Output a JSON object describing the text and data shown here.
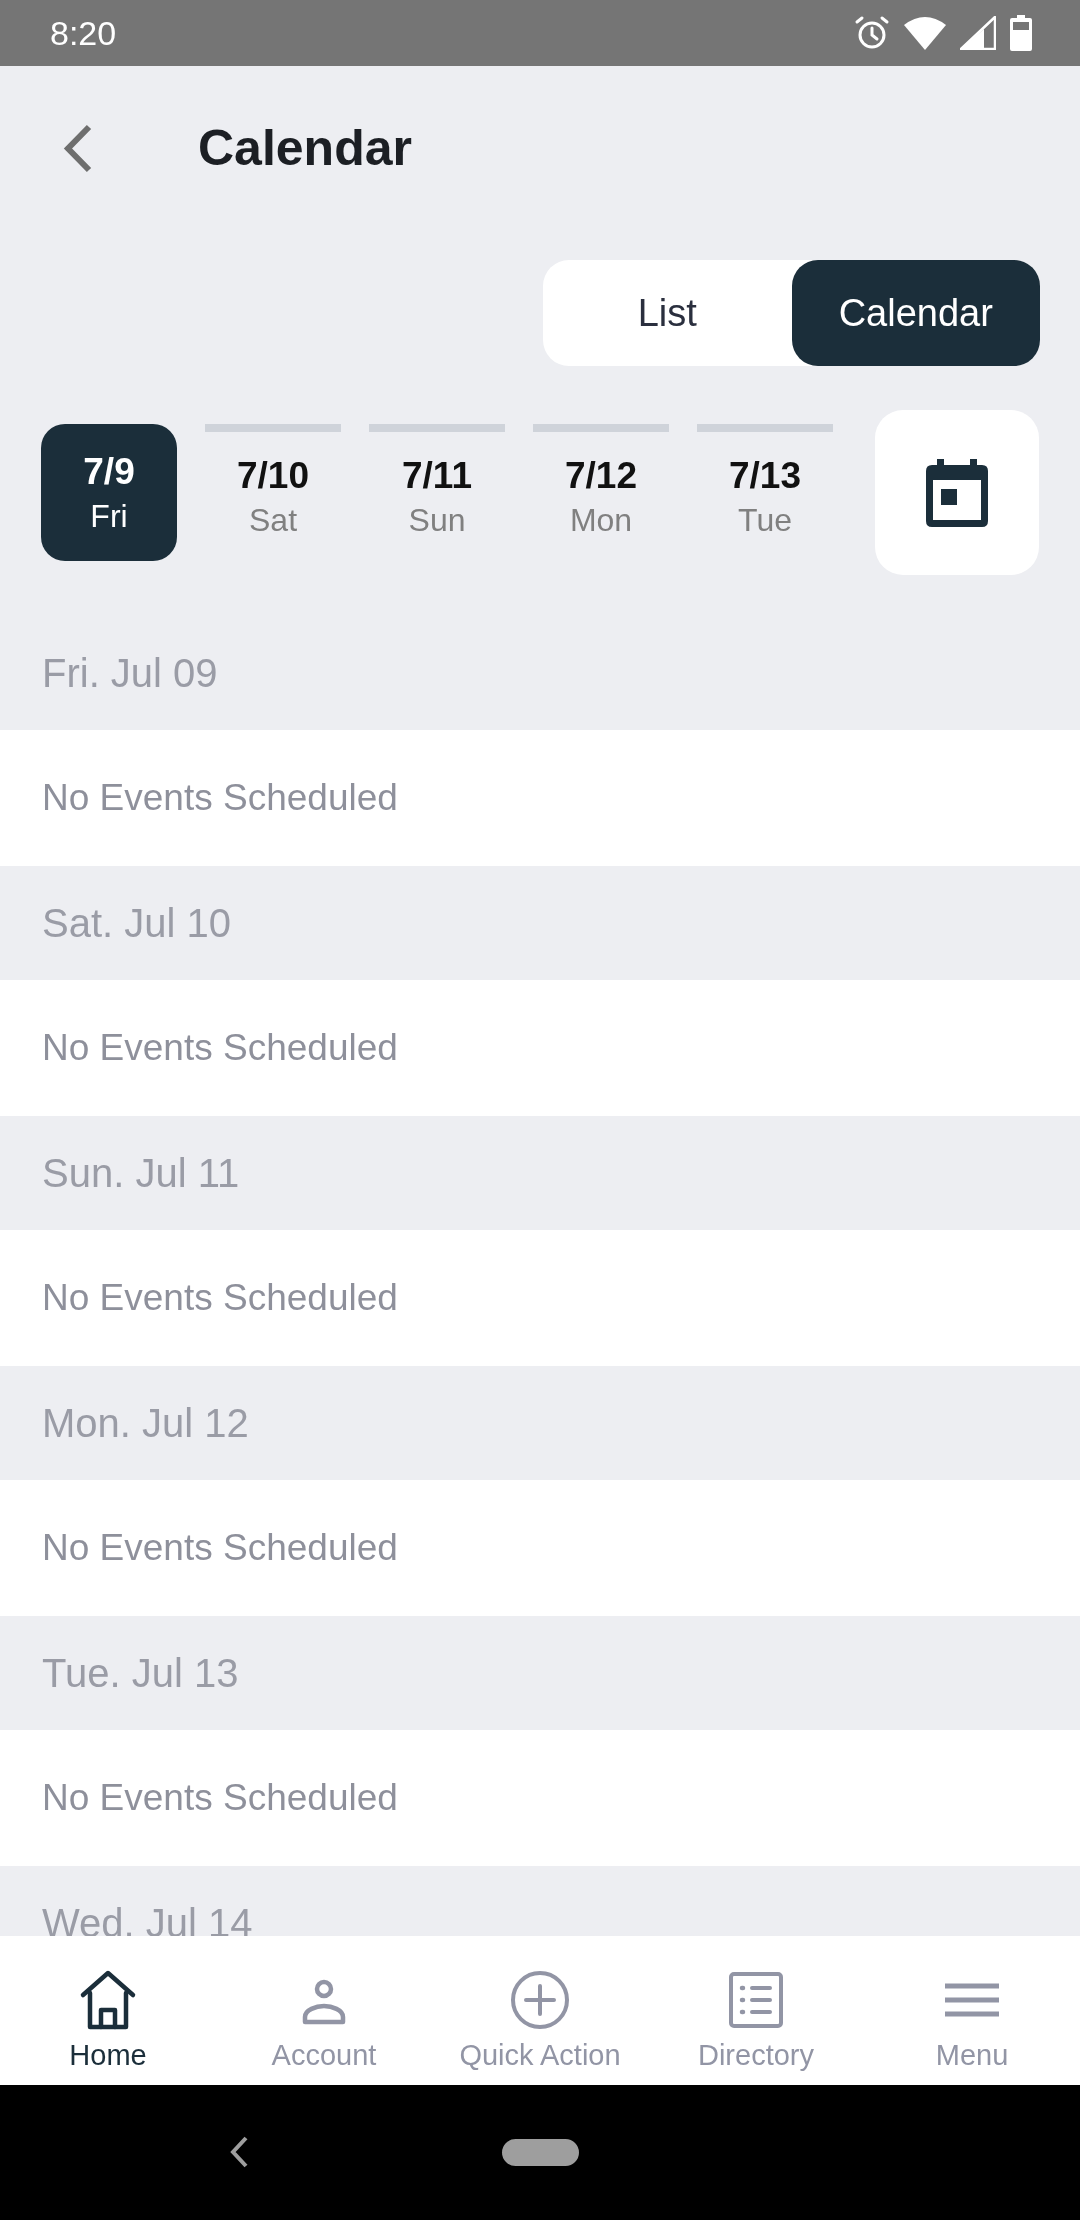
{
  "status_bar": {
    "time": "8:20"
  },
  "header": {
    "title": "Calendar"
  },
  "view_toggle": [
    {
      "label": "List",
      "selected": false
    },
    {
      "label": "Calendar",
      "selected": true
    }
  ],
  "date_strip": [
    {
      "date": "7/9",
      "day": "Fri",
      "selected": true
    },
    {
      "date": "7/10",
      "day": "Sat",
      "selected": false
    },
    {
      "date": "7/11",
      "day": "Sun",
      "selected": false
    },
    {
      "date": "7/12",
      "day": "Mon",
      "selected": false
    },
    {
      "date": "7/13",
      "day": "Tue",
      "selected": false
    }
  ],
  "days": [
    {
      "heading": "Fri. Jul 09",
      "message": "No Events Scheduled"
    },
    {
      "heading": "Sat. Jul 10",
      "message": "No Events Scheduled"
    },
    {
      "heading": "Sun. Jul 11",
      "message": "No Events Scheduled"
    },
    {
      "heading": "Mon. Jul 12",
      "message": "No Events Scheduled"
    },
    {
      "heading": "Tue. Jul 13",
      "message": "No Events Scheduled"
    },
    {
      "heading": "Wed. Jul 14"
    }
  ],
  "bottom_nav": [
    {
      "kind": "home",
      "label": "Home",
      "selected": true
    },
    {
      "kind": "account",
      "label": "Account",
      "selected": false
    },
    {
      "kind": "quick_action",
      "label": "Quick Action",
      "selected": false
    },
    {
      "kind": "directory",
      "label": "Directory",
      "selected": false
    },
    {
      "kind": "menu",
      "label": "Menu",
      "selected": false
    }
  ]
}
